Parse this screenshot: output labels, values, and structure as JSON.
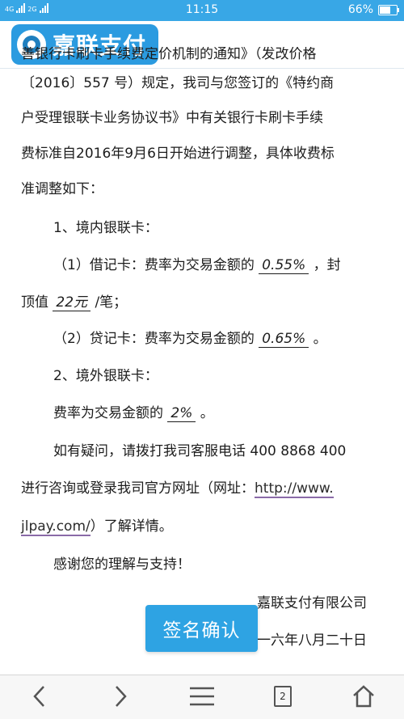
{
  "status_bar": {
    "network_tag_1": "4G",
    "network_tag_2": "2G",
    "time": "11:15",
    "battery": "66%",
    "battery_level": 0.66
  },
  "header": {
    "logo_text": "嘉联支付"
  },
  "article": {
    "line1": "善银行卡刷卡手续费定价机制的通知》（发改价格",
    "line2": "〔2016〕557 号）规定，我司与您签订的《特约商",
    "line3": "户受理银联卡业务协议书》中有关银行卡刷卡手续",
    "line4": "费标准自2016年9月6日开始进行调整，具体收费标",
    "line5": "准调整如下：",
    "section1": "1、境内银联卡：",
    "debit_prefix": "（1）借记卡：费率为交易金额的",
    "debit_rate": "0.55%",
    "debit_suffix": "，封",
    "cap_prefix": "顶值",
    "cap_value": "22元",
    "cap_suffix": "/笔；",
    "credit_prefix": "（2）贷记卡：费率为交易金额的",
    "credit_rate": "0.65%",
    "credit_suffix": "。",
    "section2": "2、境外银联卡：",
    "foreign_prefix": "费率为交易金额的",
    "foreign_rate": "2%",
    "foreign_suffix": "。",
    "contact_line": "如有疑问，请拨打我司客服电话 400 8868 400",
    "website_prefix": "进行咨询或登录我司官方网址（网址：",
    "website_link_part1": "http://www.",
    "website_link_part2": "jlpay.com/",
    "website_suffix": "）了解详情。",
    "thanks": "感谢您的理解与支持！",
    "signature_company": "嘉联支付有限公司",
    "signature_date": "一六年八月二十日"
  },
  "sign_button": {
    "label": "签名确认"
  },
  "bottom_nav": {
    "tab_count": "2"
  }
}
